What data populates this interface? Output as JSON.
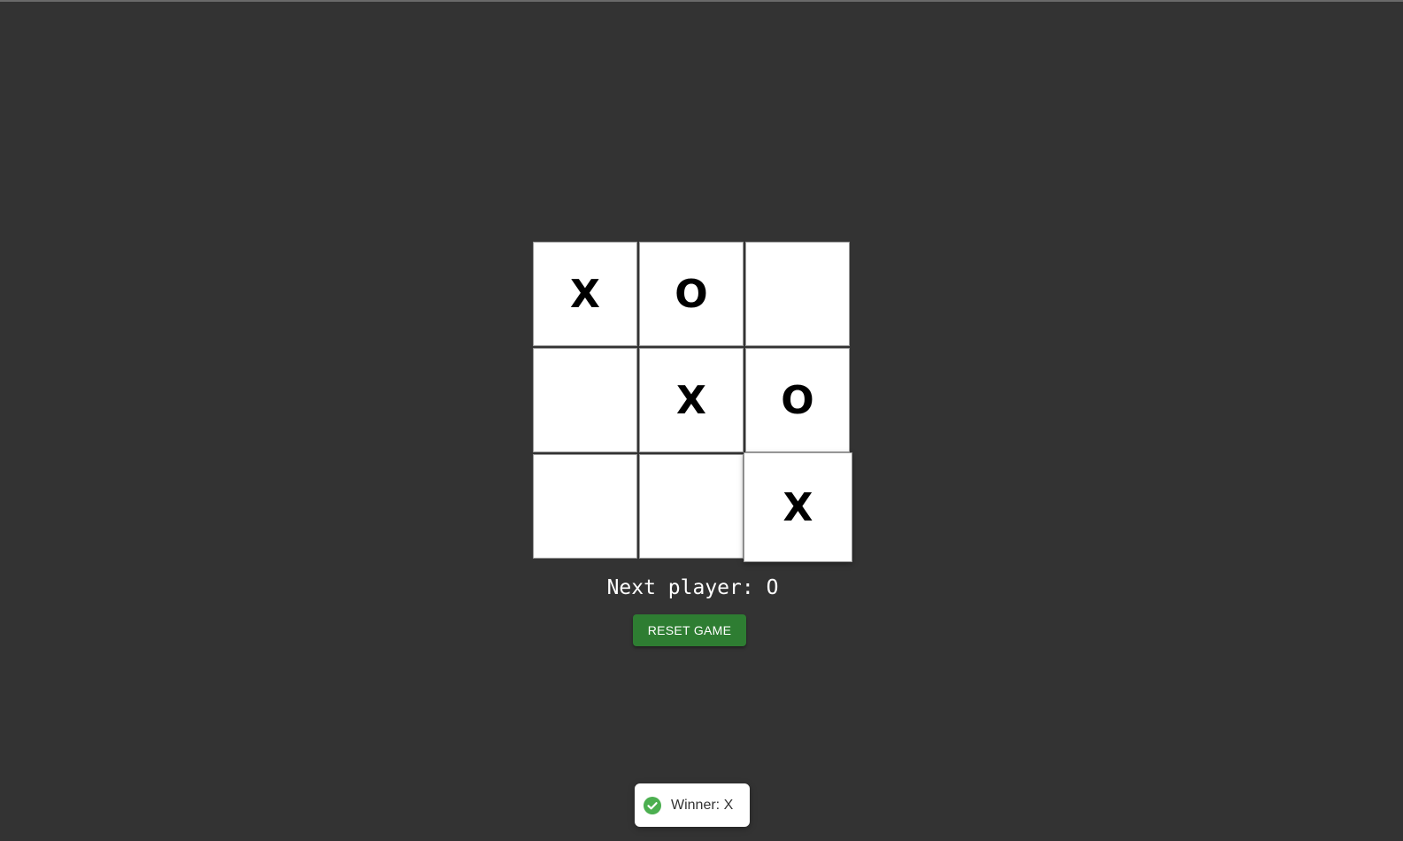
{
  "board": {
    "cells": [
      "X",
      "O",
      "",
      "",
      "X",
      "O",
      "",
      "",
      "X"
    ]
  },
  "status": {
    "next_player_text": "Next player: O"
  },
  "controls": {
    "reset_label": "RESET GAME"
  },
  "toast": {
    "message": "Winner: X",
    "icon": "check-circle-icon"
  },
  "colors": {
    "background": "#333333",
    "button": "#2e7d32",
    "success_icon": "#4caf50"
  }
}
